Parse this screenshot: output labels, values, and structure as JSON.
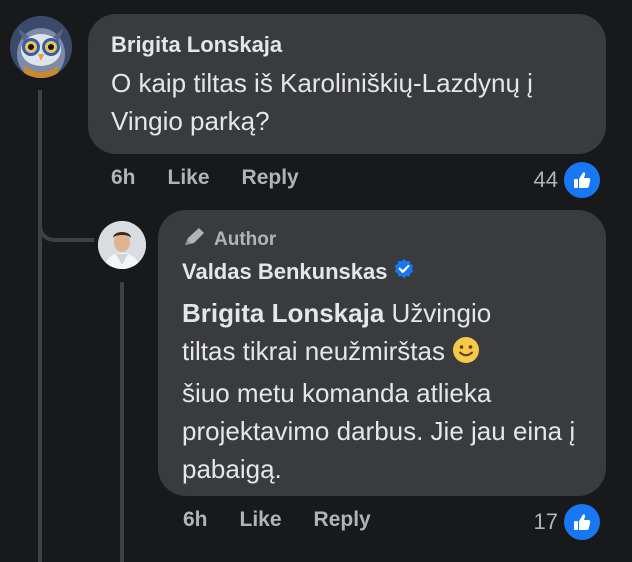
{
  "comments": [
    {
      "author": "Brigita Lonskaja",
      "text": "O kaip tiltas iš Karoliniškių-Lazdynų į Vingio parką?",
      "time": "6h",
      "like_label": "Like",
      "reply_label": "Reply",
      "reaction_count": "44",
      "avatar_icon": "owl-avatar"
    }
  ],
  "reply": {
    "badge": "Author",
    "author": "Valdas Benkunskas",
    "verified_icon": "verified-check-icon",
    "mention": "Brigita Lonskaja",
    "text_line1": " Užvingio",
    "text_line2": "tiltas tikrai neužmirštas ",
    "text_rest": "šiuo metu komanda atlieka projektavimo darbus. Jie jau eina į pabaigą.",
    "time": "6h",
    "like_label": "Like",
    "reply_label": "Reply",
    "reaction_count": "17",
    "avatar_icon": "man-avatar"
  },
  "colors": {
    "background": "#18191a",
    "bubble": "#3a3b3c",
    "accent": "#1877f2",
    "secondary_text": "#b0b3b8"
  }
}
